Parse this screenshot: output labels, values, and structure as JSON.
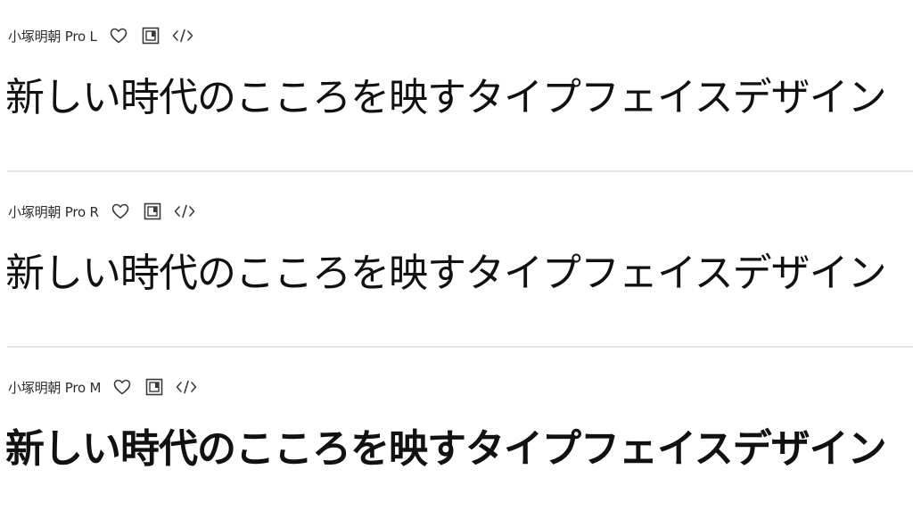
{
  "fonts": [
    {
      "name": "小塚明朝 Pro L",
      "sample": "新しい時代のこころを映すタイプフェイスデザイン"
    },
    {
      "name": "小塚明朝 Pro R",
      "sample": "新しい時代のこころを映すタイプフェイスデザイン"
    },
    {
      "name": "小塚明朝 Pro M",
      "sample": "新しい時代のこころを映すタイプフェイスデザイン"
    }
  ],
  "icons": {
    "favorite": "heart-icon",
    "add_to_project": "web-project-icon",
    "embed_code": "code-icon"
  },
  "colors": {
    "text": "#111111",
    "label": "#2c2c2c",
    "icon": "#3a3a3a",
    "divider": "#e6e6e6"
  }
}
